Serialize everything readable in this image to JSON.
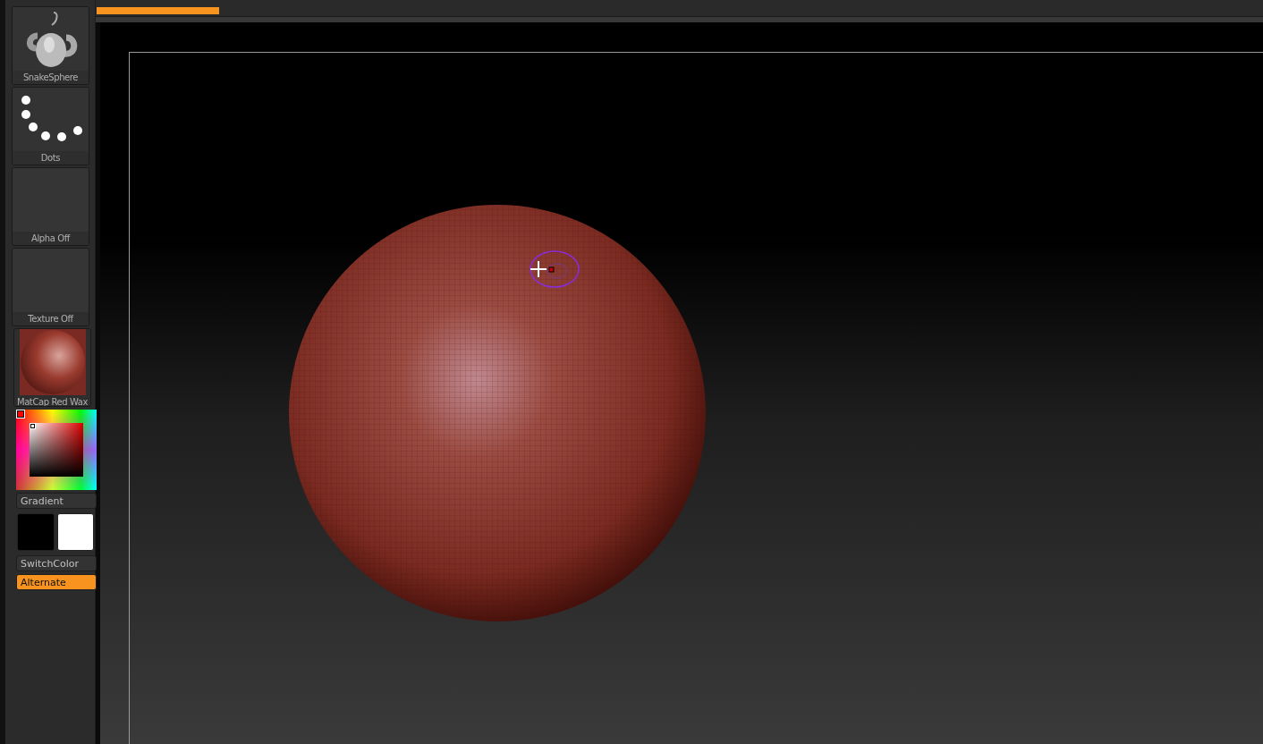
{
  "tiles": [
    {
      "kind": "brush",
      "label": "SnakeSphere"
    },
    {
      "kind": "stroke",
      "label": "Dots"
    },
    {
      "kind": "alpha",
      "label": "Alpha Off"
    },
    {
      "kind": "texture",
      "label": "Texture Off"
    },
    {
      "kind": "material",
      "label": "MatCap Red Wax"
    }
  ],
  "gradient_button": {
    "label": "Gradient"
  },
  "swatches": [
    {
      "kind": "main",
      "color": "#000000"
    },
    {
      "kind": "secondary",
      "color": "#ffffff"
    }
  ],
  "switch_color_button": {
    "label": "SwitchColor"
  },
  "alternate_button": {
    "label": "Alternate",
    "on": true
  },
  "progress": {
    "level": 0.105
  }
}
